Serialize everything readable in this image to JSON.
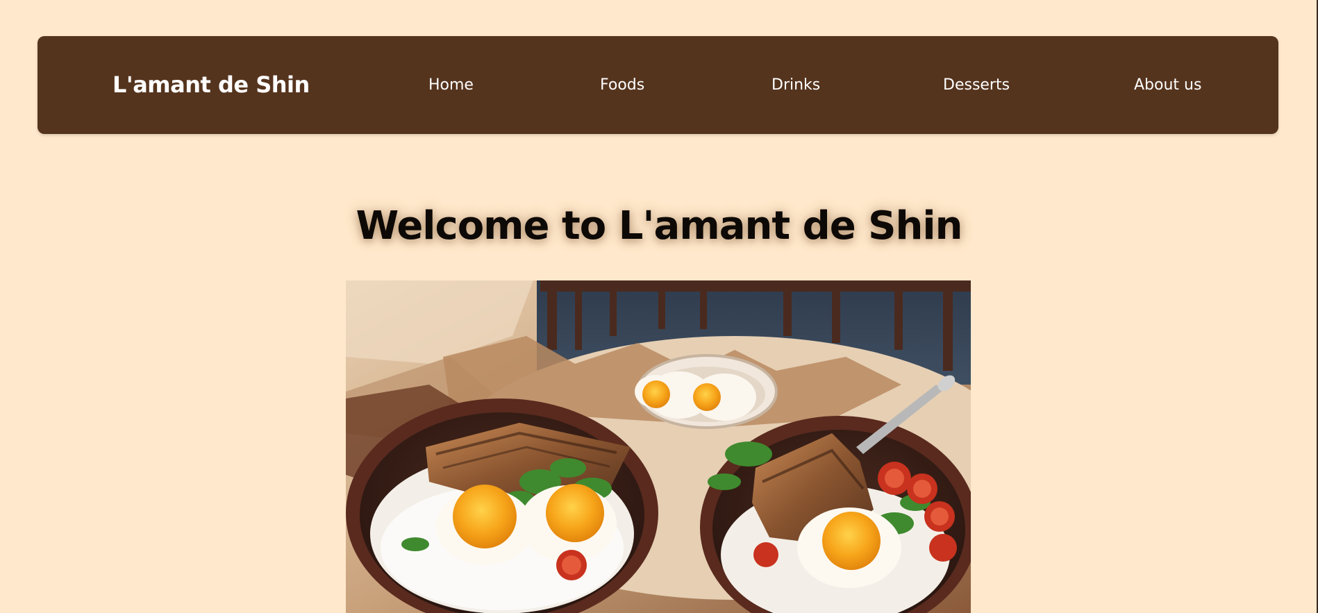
{
  "navbar": {
    "brand": "L'amant de Shin",
    "links": [
      "Home",
      "Foods",
      "Drinks",
      "Desserts",
      "About us"
    ]
  },
  "main": {
    "headline": "Welcome to L'amant de Shin",
    "hero_image": "rice-bowls-with-fried-eggs-illustration"
  },
  "colors": {
    "background": "#ffe8cb",
    "navbar": "#55341e",
    "nav_text": "#ffffff",
    "headline_text": "#0d0906"
  }
}
